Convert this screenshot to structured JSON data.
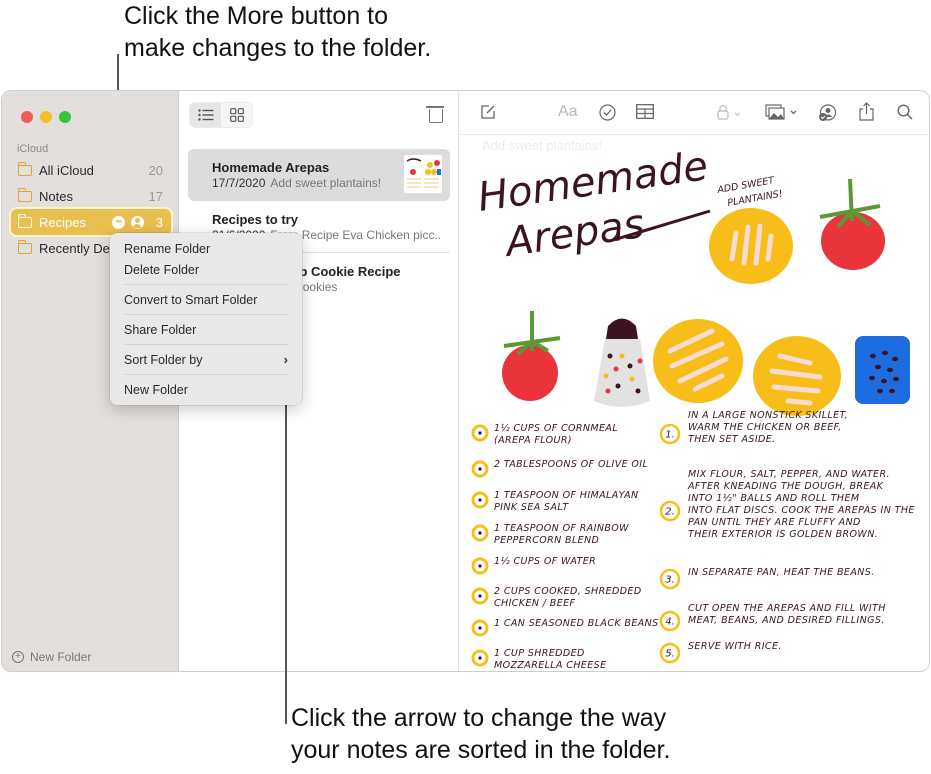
{
  "callouts": {
    "top": [
      "Click the More button to",
      "make changes to the folder."
    ],
    "bottom": [
      "Click the arrow to change the way",
      "your notes are sorted in the folder."
    ]
  },
  "sidebar": {
    "section": "iCloud",
    "folders": [
      {
        "name": "All iCloud",
        "count": "20",
        "icon": "folder-icon"
      },
      {
        "name": "Notes",
        "count": "17",
        "icon": "folder-icon"
      },
      {
        "name": "Recipes",
        "count": "3",
        "icon": "shared-folder-icon",
        "selected": true,
        "more_icon": "ellipsis-circle-icon",
        "shared_icon": "person-circle-icon"
      },
      {
        "name": "Recently Deleted",
        "count": "",
        "icon": "folder-icon"
      }
    ],
    "new_folder": "New Folder"
  },
  "context_menu": {
    "items": [
      "Rename Folder",
      "Delete Folder",
      "Convert to Smart Folder",
      "Share Folder",
      "Sort Folder by",
      "New Folder"
    ],
    "submenu_icon": "chevron-right-icon"
  },
  "note_list": {
    "view_modes": [
      "list-view-icon",
      "gallery-view-icon"
    ],
    "delete_icon": "trash-icon",
    "notes": [
      {
        "title": "Homemade Arepas",
        "date": "17/7/2020",
        "preview": "Add sweet plantains!",
        "selected": true
      },
      {
        "title": "Recipes to try",
        "date": "21/6/2020",
        "preview": "From Recipe Eva Chicken picc..."
      },
      {
        "title": "Chocolate Chip Cookie Recipe",
        "date": "",
        "preview": "Makes 4 dozen cookies"
      }
    ]
  },
  "toolbar": {
    "icons": [
      "compose-icon",
      "format-icon",
      "checklist-icon",
      "table-icon",
      "lock-icon",
      "media-icon",
      "collaborate-icon",
      "share-icon",
      "search-icon"
    ],
    "format_label": "Aa"
  },
  "editor": {
    "ghost_text": "Add sweet plantains!",
    "title": [
      "Homemade",
      "Arepas"
    ],
    "annotation": [
      "ADD SWEET",
      "PLANTAINS!"
    ],
    "ingredients": [
      [
        "1½ CUPS OF CORNMEAL",
        "(AREPA FLOUR)"
      ],
      [
        "2 TABLESPOONS OF OLIVE OIL"
      ],
      [
        "1 TEASPOON OF HIMALAYAN",
        "PINK SEA SALT"
      ],
      [
        "1 TEASPOON OF RAINBOW",
        "PEPPERCORN BLEND"
      ],
      [
        "1½ CUPS OF WATER"
      ],
      [
        "2 CUPS COOKED, SHREDDED",
        "CHICKEN / BEEF"
      ],
      [
        "1 CAN SEASONED BLACK BEANS"
      ],
      [
        "1 CUP SHREDDED",
        "MOZZARELLA CHEESE"
      ]
    ],
    "steps": [
      {
        "n": "1.",
        "lines": [
          "IN A LARGE NONSTICK SKILLET,",
          "WARM THE CHICKEN OR BEEF,",
          "THEN SET ASIDE."
        ]
      },
      {
        "n": "2.",
        "lines": [
          "MIX FLOUR, SALT, PEPPER, AND WATER.",
          "AFTER KNEADING THE DOUGH, BREAK",
          "INTO 1½\" BALLS AND ROLL THEM",
          "INTO FLAT DISCS. COOK THE AREPAS IN THE",
          "PAN UNTIL THEY ARE FLUFFY AND",
          "THEIR EXTERIOR IS GOLDEN BROWN."
        ]
      },
      {
        "n": "3.",
        "lines": [
          "IN SEPARATE PAN, HEAT THE BEANS."
        ]
      },
      {
        "n": "4.",
        "lines": [
          "CUT OPEN THE AREPAS AND FILL WITH",
          "MEAT, BEANS, AND DESIRED FILLINGS."
        ]
      },
      {
        "n": "5.",
        "lines": [
          "SERVE WITH RICE."
        ]
      }
    ]
  },
  "colors": {
    "accent": "#e9bf4f",
    "ink": "#3b1420",
    "tomato": "#e8343a",
    "arepa": "#f7be1a",
    "can": "#1d6ce0"
  }
}
